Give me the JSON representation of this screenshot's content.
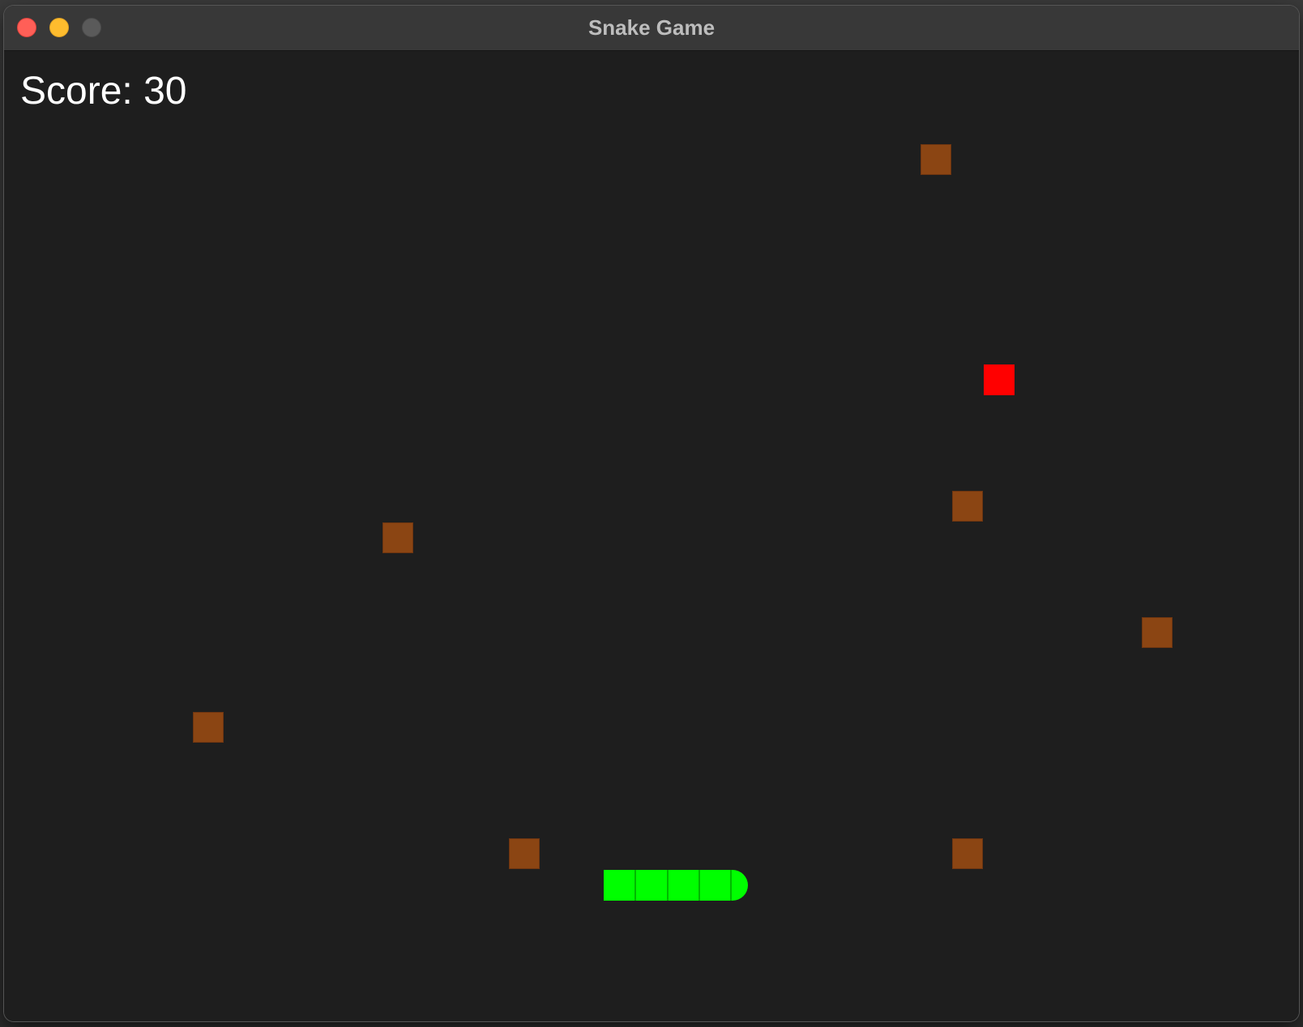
{
  "window": {
    "title": "Snake Game"
  },
  "game": {
    "score_text": "Score: 30",
    "score": 30,
    "colors": {
      "background": "#1e1e1e",
      "snake": "#00ff00",
      "food": "#ff0000",
      "obstacle": "#8b4513",
      "score_text": "#ffffff"
    },
    "snake_direction": "right",
    "snake_length": 5
  }
}
